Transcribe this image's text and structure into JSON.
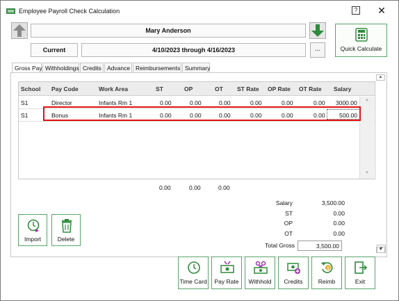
{
  "window": {
    "title": "Employee Payroll Check Calculation",
    "help_label": "?",
    "close_label": "✕"
  },
  "header": {
    "employee_name": "Mary Anderson",
    "period_label": "Current",
    "date_range": "4/10/2023 through 4/16/2023",
    "ellipsis_label": "...",
    "quick_calc_label": "Quick Calculate"
  },
  "tabs": [
    {
      "label": "Gross Pay",
      "key": "G"
    },
    {
      "label": "Withholdings",
      "key": "W"
    },
    {
      "label": "Credits",
      "key": "C"
    },
    {
      "label": "Advance",
      "key": "A"
    },
    {
      "label": "Reimbursements",
      "key": "R"
    },
    {
      "label": "Summary",
      "key": "S"
    }
  ],
  "grid": {
    "columns": [
      "School",
      "Pay Code",
      "Work Area",
      "ST",
      "OP",
      "OT",
      "ST Rate",
      "OP Rate",
      "OT Rate",
      "Salary"
    ],
    "rows": [
      [
        "S1",
        "Director",
        "Infants Rm 1",
        "0.00",
        "0.00",
        "0.00",
        "0.00",
        "0.00",
        "0.00",
        "3000.00"
      ],
      [
        "S1",
        "Bonus",
        "Infants Rm 1",
        "0.00",
        "0.00",
        "0.00",
        "0.00",
        "0.00",
        "0.00",
        "500.00"
      ]
    ],
    "totals": {
      "st": "0.00",
      "op": "0.00",
      "ot": "0.00"
    }
  },
  "summary": {
    "salary_label": "Salary",
    "salary_value": "3,500.00",
    "st_label": "ST",
    "st_value": "0.00",
    "op_label": "OP",
    "op_value": "0.00",
    "ot_label": "OT",
    "ot_value": "0.00",
    "gross_label": "Total Gross",
    "gross_value": "3,500.00"
  },
  "side_buttons": {
    "import_label": "Import",
    "delete_label": "Delete"
  },
  "bottom_buttons": {
    "time_card": "Time Card",
    "pay_rate": "Pay Rate",
    "withhold": "Withhold",
    "credits": "Credits",
    "reimb": "Reimb",
    "exit": "Exit"
  },
  "colors": {
    "accent_green": "#2e8b3c",
    "highlight_red": "#e01010"
  }
}
